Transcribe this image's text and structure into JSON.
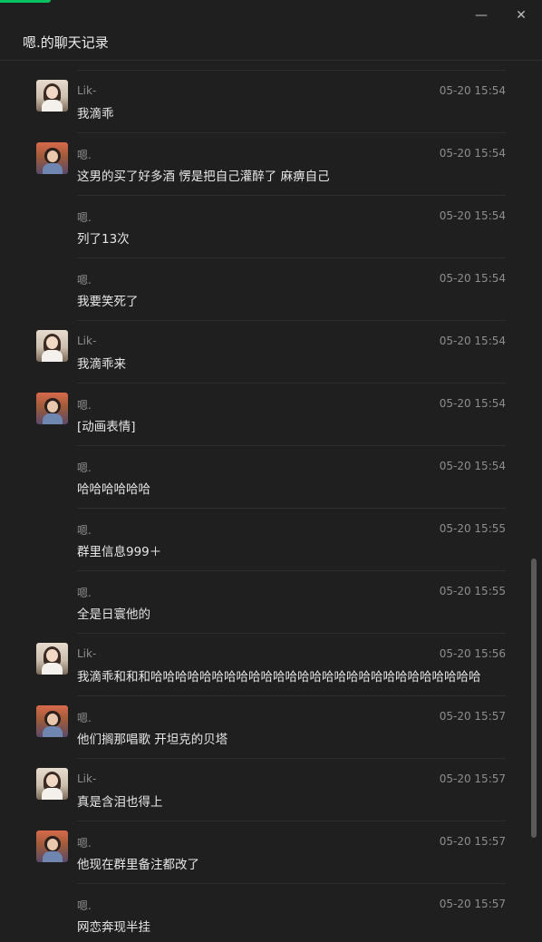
{
  "window": {
    "title": "嗯.的聊天记录",
    "minimize_glyph": "—",
    "close_glyph": "✕",
    "accent_color": "#07c160"
  },
  "messages": [
    {
      "name": "Lik-",
      "avatar": "lik-avatar",
      "time": "05-20 15:54",
      "text": "我滴乖"
    },
    {
      "name": "嗯.",
      "avatar": "en-avatar",
      "time": "05-20 15:54",
      "text": "这男的买了好多酒   愣是把自己灌醉了  麻痹自己"
    },
    {
      "name": "嗯.",
      "avatar": null,
      "time": "05-20 15:54",
      "text": "列了13次"
    },
    {
      "name": "嗯.",
      "avatar": null,
      "time": "05-20 15:54",
      "text": "我要笑死了"
    },
    {
      "name": "Lik-",
      "avatar": "lik-avatar",
      "time": "05-20 15:54",
      "text": "我滴乖来"
    },
    {
      "name": "嗯.",
      "avatar": "en-avatar",
      "time": "05-20 15:54",
      "text": "[动画表情]"
    },
    {
      "name": "嗯.",
      "avatar": null,
      "time": "05-20 15:54",
      "text": "哈哈哈哈哈哈"
    },
    {
      "name": "嗯.",
      "avatar": null,
      "time": "05-20 15:55",
      "text": "群里信息999＋"
    },
    {
      "name": "嗯.",
      "avatar": null,
      "time": "05-20 15:55",
      "text": "全是日寰他的"
    },
    {
      "name": "Lik-",
      "avatar": "lik-avatar",
      "time": "05-20 15:56",
      "text": "我滴乖和和和哈哈哈哈哈哈哈哈哈哈哈哈哈哈哈哈哈哈哈哈哈哈哈哈哈哈哈"
    },
    {
      "name": "嗯.",
      "avatar": "en-avatar",
      "time": "05-20 15:57",
      "text": "他们搁那唱歌   开坦克的贝塔"
    },
    {
      "name": "Lik-",
      "avatar": "lik-avatar",
      "time": "05-20 15:57",
      "text": "真是含泪也得上"
    },
    {
      "name": "嗯.",
      "avatar": "en-avatar",
      "time": "05-20 15:57",
      "text": "他现在群里备注都改了"
    },
    {
      "name": "嗯.",
      "avatar": null,
      "time": "05-20 15:57",
      "text": "网恋奔现半挂"
    }
  ]
}
